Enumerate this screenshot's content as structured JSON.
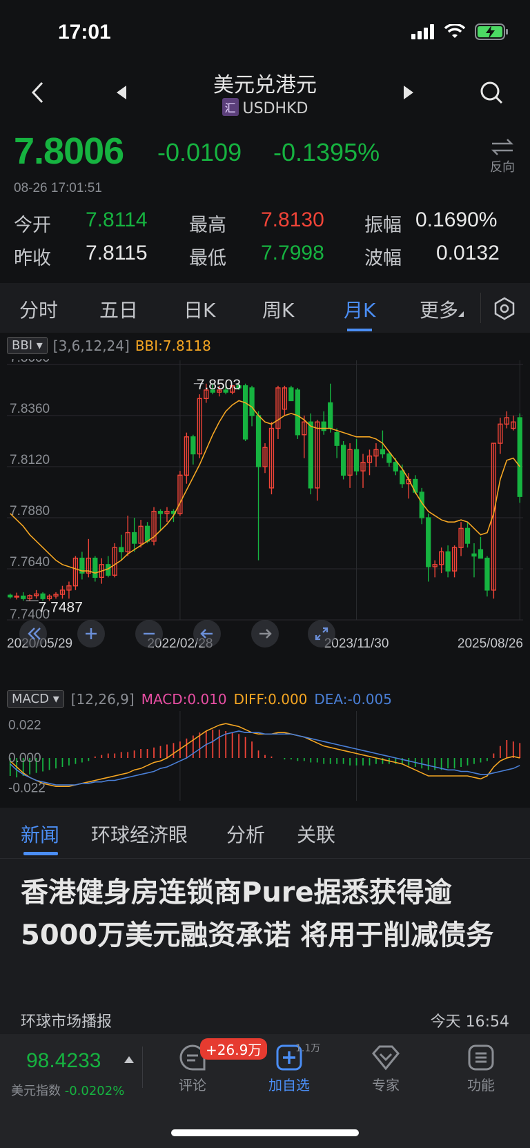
{
  "status_bar": {
    "time": "17:01"
  },
  "nav": {
    "title": "美元兑港元",
    "badge": "汇",
    "symbol": "USDHKD"
  },
  "quote": {
    "price": "7.8006",
    "change": "-0.0109",
    "change_pct": "-0.1395%",
    "reverse_label": "反向",
    "timestamp": "08-26 17:01:51"
  },
  "stats": [
    {
      "label": "今开",
      "value": "7.8114",
      "color": "#16b340"
    },
    {
      "label": "最高",
      "value": "7.8130",
      "color": "#f04438"
    },
    {
      "label": "振幅",
      "value": "0.1690%",
      "color": "#e8e8e8"
    },
    {
      "label": "昨收",
      "value": "7.8115",
      "color": "#e8e8e8"
    },
    {
      "label": "最低",
      "value": "7.7998",
      "color": "#16b340"
    },
    {
      "label": "波幅",
      "value": "0.0132",
      "color": "#e8e8e8"
    }
  ],
  "tabs": [
    "分时",
    "五日",
    "日K",
    "周K",
    "月K",
    "更多"
  ],
  "active_tab": "月K",
  "main_indicator": {
    "name": "BBI",
    "params": "[3,6,12,24]",
    "value": "BBI:7.8118"
  },
  "sub_indicator": {
    "name": "MACD",
    "params": "[12,26,9]",
    "macd": "MACD:0.010",
    "diff": "DIFF:0.000",
    "dea": "DEA:-0.005"
  },
  "chart_data": {
    "type": "candlestick",
    "y_ticks": [
      "7.8600",
      "7.8360",
      "7.8120",
      "7.7880",
      "7.7640",
      "7.7400"
    ],
    "ylim": [
      7.74,
      7.86
    ],
    "x_ticks": [
      "2020/05/29",
      "2022/02/28",
      "2023/11/30",
      "2025/08/26"
    ],
    "high_label": "7.8503",
    "low_label": "7.7487",
    "macd_ticks": [
      "0.022",
      "0.000",
      "-0.022"
    ],
    "macd_ylim": [
      -0.024,
      0.024
    ],
    "up_color": "#f04438",
    "down_color": "#16b340",
    "bbi_color": "#f5a623",
    "diff_color": "#f5a623",
    "dea_color": "#4a7fd6",
    "candles": [
      [
        7.7516,
        7.7524,
        7.75,
        7.7508
      ],
      [
        7.7508,
        7.7528,
        7.7496,
        7.7512
      ],
      [
        7.7512,
        7.753,
        7.749,
        7.75
      ],
      [
        7.75,
        7.752,
        7.749,
        7.7514
      ],
      [
        7.7514,
        7.754,
        7.75,
        7.7522
      ],
      [
        7.7522,
        7.753,
        7.749,
        7.75
      ],
      [
        7.75,
        7.752,
        7.749,
        7.7512
      ],
      [
        7.7512,
        7.753,
        7.75,
        7.752
      ],
      [
        7.752,
        7.756,
        7.75,
        7.754
      ],
      [
        7.754,
        7.758,
        7.75,
        7.756
      ],
      [
        7.756,
        7.77,
        7.754,
        7.769
      ],
      [
        7.769,
        7.772,
        7.759,
        7.762
      ],
      [
        7.762,
        7.778,
        7.76,
        7.769
      ],
      [
        7.769,
        7.77,
        7.758,
        7.76
      ],
      [
        7.76,
        7.769,
        7.757,
        7.766
      ],
      [
        7.766,
        7.77,
        7.76,
        7.761
      ],
      [
        7.761,
        7.776,
        7.76,
        7.774
      ],
      [
        7.774,
        7.78,
        7.768,
        7.772
      ],
      [
        7.772,
        7.789,
        7.77,
        7.781
      ],
      [
        7.781,
        7.788,
        7.772,
        7.776
      ],
      [
        7.776,
        7.787,
        7.774,
        7.784
      ],
      [
        7.784,
        7.786,
        7.776,
        7.777
      ],
      [
        7.777,
        7.793,
        7.775,
        7.791
      ],
      [
        7.791,
        7.792,
        7.782,
        7.79
      ],
      [
        7.79,
        7.793,
        7.786,
        7.791
      ],
      [
        7.791,
        7.792,
        7.786,
        7.79
      ],
      [
        7.79,
        7.81,
        7.789,
        7.808
      ],
      [
        7.808,
        7.828,
        7.804,
        7.826
      ],
      [
        7.826,
        7.827,
        7.813,
        7.818
      ],
      [
        7.818,
        7.846,
        7.816,
        7.844
      ],
      [
        7.844,
        7.851,
        7.842,
        7.848
      ],
      [
        7.848,
        7.851,
        7.846,
        7.847
      ],
      [
        7.847,
        7.85,
        7.845,
        7.848
      ],
      [
        7.848,
        7.85,
        7.846,
        7.847
      ],
      [
        7.847,
        7.8503,
        7.846,
        7.85
      ],
      [
        7.85,
        7.851,
        7.848,
        7.849
      ],
      [
        7.85,
        7.851,
        7.824,
        7.825
      ],
      [
        7.849,
        7.85,
        7.831,
        7.836
      ],
      [
        7.836,
        7.838,
        7.768,
        7.812
      ],
      [
        7.812,
        7.823,
        7.809,
        7.821
      ],
      [
        7.802,
        7.833,
        7.799,
        7.83
      ],
      [
        7.83,
        7.85,
        7.825,
        7.849
      ],
      [
        7.839,
        7.85,
        7.836,
        7.849
      ],
      [
        7.849,
        7.85,
        7.843,
        7.843
      ],
      [
        7.848,
        7.849,
        7.825,
        7.827
      ],
      [
        7.827,
        7.836,
        7.816,
        7.833
      ],
      [
        7.833,
        7.837,
        7.799,
        7.802
      ],
      [
        7.802,
        7.834,
        7.796,
        7.833
      ],
      [
        7.833,
        7.838,
        7.827,
        7.829
      ],
      [
        7.842,
        7.851,
        7.828,
        7.83
      ],
      [
        7.828,
        7.83,
        7.816,
        7.822
      ],
      [
        7.822,
        7.824,
        7.806,
        7.808
      ],
      [
        7.808,
        7.823,
        7.802,
        7.82
      ],
      [
        7.82,
        7.825,
        7.808,
        7.81
      ],
      [
        7.81,
        7.818,
        7.802,
        7.814
      ],
      [
        7.814,
        7.82,
        7.808,
        7.817
      ],
      [
        7.817,
        7.823,
        7.812,
        7.82
      ],
      [
        7.82,
        7.829,
        7.816,
        7.818
      ],
      [
        7.818,
        7.819,
        7.812,
        7.814
      ],
      [
        7.814,
        7.816,
        7.808,
        7.81
      ],
      [
        7.81,
        7.813,
        7.802,
        7.804
      ],
      [
        7.804,
        7.809,
        7.797,
        7.806
      ],
      [
        7.806,
        7.808,
        7.799,
        7.8
      ],
      [
        7.8,
        7.802,
        7.785,
        7.788
      ],
      [
        7.788,
        7.79,
        7.758,
        7.765
      ],
      [
        7.765,
        7.768,
        7.76,
        7.766
      ],
      [
        7.766,
        7.774,
        7.762,
        7.772
      ],
      [
        7.772,
        7.775,
        7.76,
        7.763
      ],
      [
        7.763,
        7.775,
        7.76,
        7.774
      ],
      [
        7.774,
        7.786,
        7.77,
        7.783
      ],
      [
        7.783,
        7.786,
        7.774,
        7.776
      ],
      [
        7.771,
        7.776,
        7.76,
        7.77
      ],
      [
        7.773,
        7.779,
        7.77,
        7.769
      ],
      [
        7.769,
        7.77,
        7.751,
        7.754
      ],
      [
        7.754,
        7.823,
        7.75,
        7.823
      ],
      [
        7.823,
        7.835,
        7.818,
        7.832
      ],
      [
        7.832,
        7.838,
        7.83,
        7.835
      ],
      [
        7.83,
        7.836,
        7.829,
        7.833
      ],
      [
        7.835,
        7.837,
        7.795,
        7.798
      ]
    ],
    "bbi": [
      7.79,
      7.787,
      7.784,
      7.78,
      7.777,
      7.774,
      7.771,
      7.768,
      7.766,
      7.765,
      7.764,
      7.763,
      7.763,
      7.762,
      7.763,
      7.764,
      7.766,
      7.768,
      7.771,
      7.773,
      7.775,
      7.777,
      7.779,
      7.782,
      7.785,
      7.789,
      7.795,
      7.801,
      7.807,
      7.813,
      7.82,
      7.827,
      7.833,
      7.838,
      7.841,
      7.843,
      7.842,
      7.84,
      7.836,
      7.833,
      7.832,
      7.834,
      7.836,
      7.837,
      7.836,
      7.834,
      7.831,
      7.83,
      7.83,
      7.83,
      7.829,
      7.828,
      7.827,
      7.826,
      7.826,
      7.826,
      7.825,
      7.823,
      7.819,
      7.815,
      7.811,
      7.806,
      7.8,
      7.795,
      7.791,
      7.789,
      7.787,
      7.786,
      7.786,
      7.787,
      7.786,
      7.783,
      7.78,
      7.781,
      7.79,
      7.806,
      7.815,
      7.816,
      7.812
    ],
    "macd_hist": [
      -0.012,
      -0.013,
      -0.012,
      -0.011,
      -0.01,
      -0.009,
      -0.008,
      -0.007,
      -0.006,
      -0.005,
      -0.004,
      -0.003,
      -0.002,
      0.001,
      0.002,
      0.003,
      0.003,
      0.004,
      0.004,
      0.005,
      0.006,
      0.006,
      0.007,
      0.008,
      0.009,
      0.01,
      0.011,
      0.013,
      0.015,
      0.017,
      0.018,
      0.019,
      0.019,
      0.018,
      0.017,
      0.016,
      0.014,
      0.011,
      0.005,
      0.002,
      0.001,
      0.0,
      -0.001,
      -0.001,
      -0.002,
      -0.002,
      -0.003,
      -0.003,
      -0.004,
      -0.004,
      -0.004,
      -0.004,
      -0.005,
      -0.005,
      -0.005,
      -0.005,
      -0.004,
      -0.004,
      -0.004,
      -0.004,
      -0.004,
      -0.005,
      -0.006,
      -0.007,
      -0.008,
      -0.008,
      -0.008,
      -0.007,
      -0.007,
      -0.006,
      -0.005,
      -0.004,
      -0.003,
      -0.002,
      0.003,
      0.008,
      0.012,
      0.011,
      0.01
    ],
    "diff": [
      -0.002,
      -0.006,
      -0.01,
      -0.013,
      -0.015,
      -0.017,
      -0.018,
      -0.019,
      -0.019,
      -0.019,
      -0.018,
      -0.017,
      -0.016,
      -0.015,
      -0.014,
      -0.013,
      -0.012,
      -0.011,
      -0.01,
      -0.008,
      -0.007,
      -0.005,
      -0.003,
      -0.002,
      0.0,
      0.003,
      0.006,
      0.009,
      0.012,
      0.015,
      0.018,
      0.02,
      0.022,
      0.023,
      0.022,
      0.021,
      0.019,
      0.017,
      0.016,
      0.016,
      0.016,
      0.017,
      0.017,
      0.016,
      0.015,
      0.014,
      0.012,
      0.01,
      0.008,
      0.007,
      0.006,
      0.005,
      0.004,
      0.003,
      0.002,
      0.001,
      0.0,
      -0.001,
      -0.002,
      -0.003,
      -0.004,
      -0.006,
      -0.008,
      -0.01,
      -0.012,
      -0.012,
      -0.012,
      -0.012,
      -0.012,
      -0.012,
      -0.012,
      -0.013,
      -0.014,
      -0.012,
      -0.006,
      -0.002,
      0.0,
      0.001,
      0.0
    ],
    "dea": [
      -0.004,
      -0.008,
      -0.011,
      -0.013,
      -0.015,
      -0.016,
      -0.017,
      -0.018,
      -0.018,
      -0.018,
      -0.018,
      -0.017,
      -0.017,
      -0.016,
      -0.016,
      -0.015,
      -0.015,
      -0.014,
      -0.013,
      -0.012,
      -0.011,
      -0.01,
      -0.009,
      -0.007,
      -0.006,
      -0.004,
      -0.002,
      0.0,
      0.003,
      0.006,
      0.009,
      0.011,
      0.014,
      0.016,
      0.017,
      0.018,
      0.017,
      0.017,
      0.017,
      0.016,
      0.016,
      0.016,
      0.016,
      0.016,
      0.015,
      0.014,
      0.013,
      0.012,
      0.011,
      0.01,
      0.009,
      0.008,
      0.007,
      0.006,
      0.005,
      0.004,
      0.003,
      0.002,
      0.001,
      0.0,
      -0.001,
      -0.002,
      -0.003,
      -0.004,
      -0.005,
      -0.006,
      -0.007,
      -0.008,
      -0.008,
      -0.009,
      -0.009,
      -0.01,
      -0.011,
      -0.011,
      -0.01,
      -0.009,
      -0.008,
      -0.007,
      -0.005
    ]
  },
  "sub_tabs": [
    "新闻",
    "环球经济眼",
    "分析",
    "关联"
  ],
  "news": {
    "title": "香港健身房连锁商Pure据悉获得逾5000万美元融资承诺 将用于削减债务",
    "source": "环球市场播报",
    "time": "今天 16:54"
  },
  "bottom_bar": {
    "index_value": "98.4233",
    "index_name": "美元指数",
    "index_change": "-0.0202%",
    "comment_label": "评论",
    "comment_badge": "+26.9万",
    "watch_label": "加自选",
    "watch_badge": "1.1万",
    "expert_label": "专家",
    "function_label": "功能"
  }
}
